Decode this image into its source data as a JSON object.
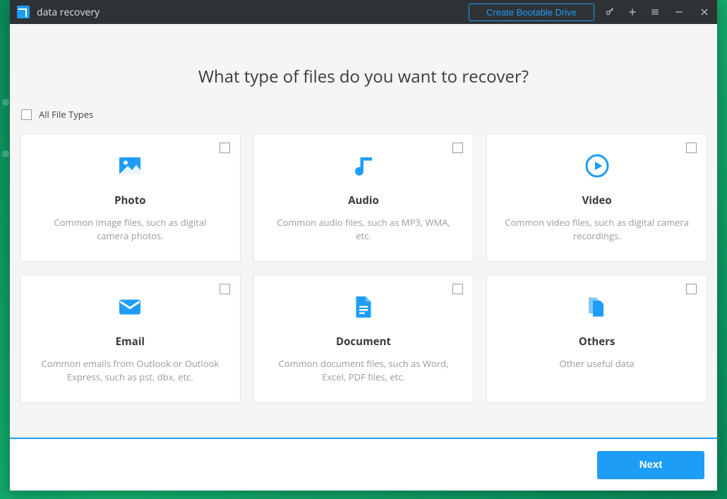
{
  "titlebar": {
    "app_title": "data recovery",
    "bootable_label": "Create Bootable Drive"
  },
  "headline": "What type of files do you want to recover?",
  "all_files_label": "All File Types",
  "cards": [
    {
      "title": "Photo",
      "desc": "Common image files, such as digital camera photos.",
      "icon": "photo-icon"
    },
    {
      "title": "Audio",
      "desc": "Common audio files, such as MP3, WMA, etc.",
      "icon": "audio-icon"
    },
    {
      "title": "Video",
      "desc": "Common video files, such as digital camera recordings.",
      "icon": "video-icon"
    },
    {
      "title": "Email",
      "desc": "Common emails from Outlook or Outlook Express, such as pst, dbx, etc.",
      "icon": "email-icon"
    },
    {
      "title": "Document",
      "desc": "Common document files, such as Word, Excel, PDF files, etc.",
      "icon": "document-icon"
    },
    {
      "title": "Others",
      "desc": "Other useful data",
      "icon": "others-icon"
    }
  ],
  "footer": {
    "next_label": "Next"
  },
  "colors": {
    "accent": "#1e9df7"
  }
}
